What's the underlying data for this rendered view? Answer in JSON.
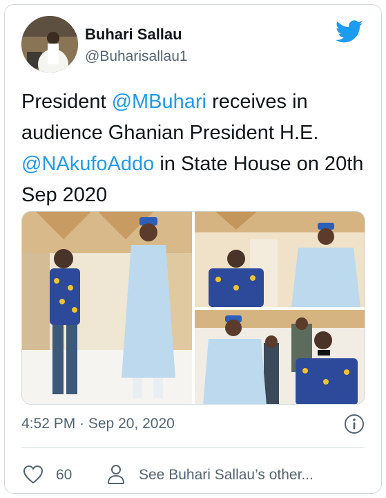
{
  "author": {
    "name": "Buhari Sallau",
    "handle": "@Buharisallau1"
  },
  "tweet": {
    "part1": "President ",
    "mention1": "@MBuhari",
    "part2": " receives in audience Ghanian President H.E. ",
    "mention2": "@NAkufoAddo",
    "part3": " in State House on 20th Sep 2020"
  },
  "meta": {
    "timestamp": "4:52 PM · Sep 20, 2020"
  },
  "actions": {
    "like_count": "60",
    "see_other": "See Buhari Sallau’s other..."
  },
  "colors": {
    "accent": "#1d9bf0",
    "secondary_text": "#536471",
    "border": "#cfd9de"
  },
  "icons": {
    "brand": "twitter-bird-icon",
    "info": "info-icon",
    "like": "heart-icon",
    "profile": "person-icon"
  }
}
